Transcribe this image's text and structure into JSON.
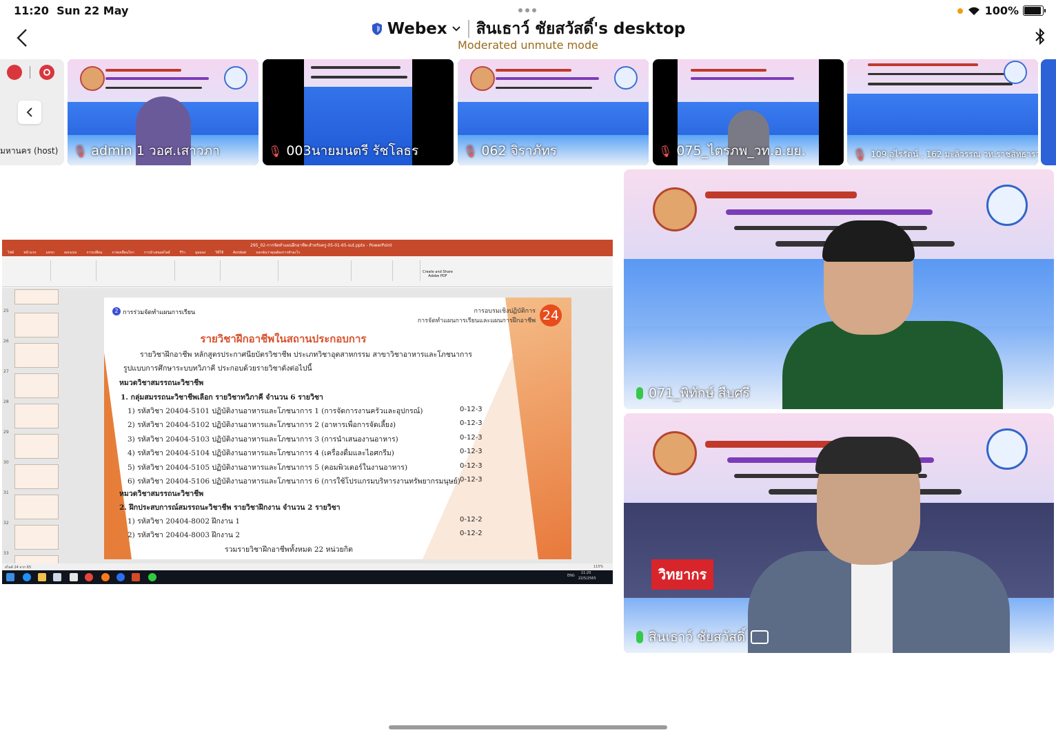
{
  "status": {
    "time": "11:20",
    "date": "Sun 22 May",
    "battery": "100%",
    "battery_level": 1.0
  },
  "header": {
    "app_name": "Webex",
    "meeting_title": "สินเธาว์ ชัยสวัสดิ์'s desktop",
    "mode": "Moderated unmute mode"
  },
  "host": {
    "name": "มหานคร (host)"
  },
  "participants": [
    {
      "name": "admin 1 วอศ.เสาวภา"
    },
    {
      "name": "003นายมนตรี รัชโลธร"
    },
    {
      "name": "062 จิราภัทร"
    },
    {
      "name": "075_ไตรภพ_วท.อ.ยย."
    },
    {
      "name": "109 อุไรรัตน์ , 162 มะลิวรรณ วท.ราชสิทธาราม"
    }
  ],
  "share": {
    "window_title": "295_02-การจัดทำแผนฝึกอาชีพ-สำหรับครู-05-01-65-sut.pptx - PowerPoint",
    "tabs": [
      "ไฟล์",
      "หน้าแรก",
      "แทรก",
      "ออกแบบ",
      "การเปลี่ยน",
      "ภาพเคลื่อนไหว",
      "การนำเสนอสไลด์",
      "รีวิว",
      "มุมมอง",
      "วิธีใช้",
      "Acrobat",
      "บอกฉันว่าคุณต้องการทำอะไร"
    ],
    "ribbon_button": "Create and Share Adobe PDF",
    "slide_numbers": [
      "25",
      "26",
      "27",
      "28",
      "29",
      "30",
      "31",
      "32",
      "33"
    ],
    "status_left": "สไลด์ 24 จาก 65",
    "zoom": "115%",
    "clock_time": "11:20",
    "clock_date": "22/5/2565",
    "lang": "ENG"
  },
  "slide": {
    "page_number": "24",
    "section_no": "2",
    "section_label": "การร่วมจัดทำแผนการเรียน",
    "header_right_1": "การอบรมเชิงปฏิบัติการ",
    "header_right_2": "การจัดทำแผนการเรียนและแผนการฝึกอาชีพ",
    "title": "รายวิชาฝึกอาชีพในสถานประกอบการ",
    "intro_1": "รายวิชาฝึกอาชีพ หลักสูตรประกาศนียบัตรวิชาชีพ ประเภทวิชาอุตสาหกรรม สาขาวิชาอาหารและโภชนาการ",
    "intro_2": "รูปแบบการศึกษาระบบทวิภาคี ประกอบด้วยรายวิชาดังต่อไปนี้",
    "group_1": "หมวดวิชาสมรรถนะวิชาชีพ",
    "group_1_sub": "1. กลุ่มสมรรถนะวิชาชีพเลือก รายวิชาทวิภาคี จำนวน 6 รายวิชา",
    "courses_1": [
      {
        "text": "1) รหัสวิชา 20404-5101  ปฏิบัติงานอาหารและโภชนาการ 1 (การจัดการงานครัวและอุปกรณ์)",
        "code": "0-12-3"
      },
      {
        "text": "2) รหัสวิชา 20404-5102  ปฏิบัติงานอาหารและโภชนาการ 2 (อาหารเพื่อการจัดเลี้ยง)",
        "code": "0-12-3"
      },
      {
        "text": "3) รหัสวิชา 20404-5103  ปฏิบัติงานอาหารและโภชนาการ 3 (การนำเสนองานอาหาร)",
        "code": "0-12-3"
      },
      {
        "text": "4) รหัสวิชา 20404-5104  ปฏิบัติงานอาหารและโภชนาการ 4 (เครื่องดื่มและไอศกรีม)",
        "code": "0-12-3"
      },
      {
        "text": "5) รหัสวิชา 20404-5105  ปฏิบัติงานอาหารและโภชนาการ 5 (คอมพิวเตอร์ในงานอาหาร)",
        "code": "0-12-3"
      },
      {
        "text": "6) รหัสวิชา 20404-5106  ปฏิบัติงานอาหารและโภชนาการ 6 (การใช้โปรแกรมบริหารงานทรัพยากรมนุษย์)",
        "code": "0-12-3"
      }
    ],
    "group_2": "หมวดวิชาสมรรถนะวิชาชีพ",
    "group_2_sub": "2. ฝึกประสบการณ์สมรรถนะวิชาชีพ รายวิชาฝึกงาน จำนวน 2 รายวิชา",
    "courses_2": [
      {
        "text": "1) รหัสวิชา 20404-8002  ฝึกงาน 1",
        "code": "0-12-2"
      },
      {
        "text": "2) รหัสวิชา 20404-8003  ฝึกงาน 2",
        "code": "0-12-2"
      }
    ],
    "total": "รวมรายวิชาฝึกอาชีพทั้งหมด  22  หน่วยกิต"
  },
  "videos": [
    {
      "name": "071_พิทักษ์ สืบศรี"
    },
    {
      "name": "สินเธาว์ ชัยสวัสดิ์",
      "tag": "วิทยากร"
    }
  ],
  "colors": {
    "accent": "#9a6b1b",
    "mute": "#d9363e",
    "mic_on": "#37c84a",
    "ppt_red": "#c7492b"
  }
}
